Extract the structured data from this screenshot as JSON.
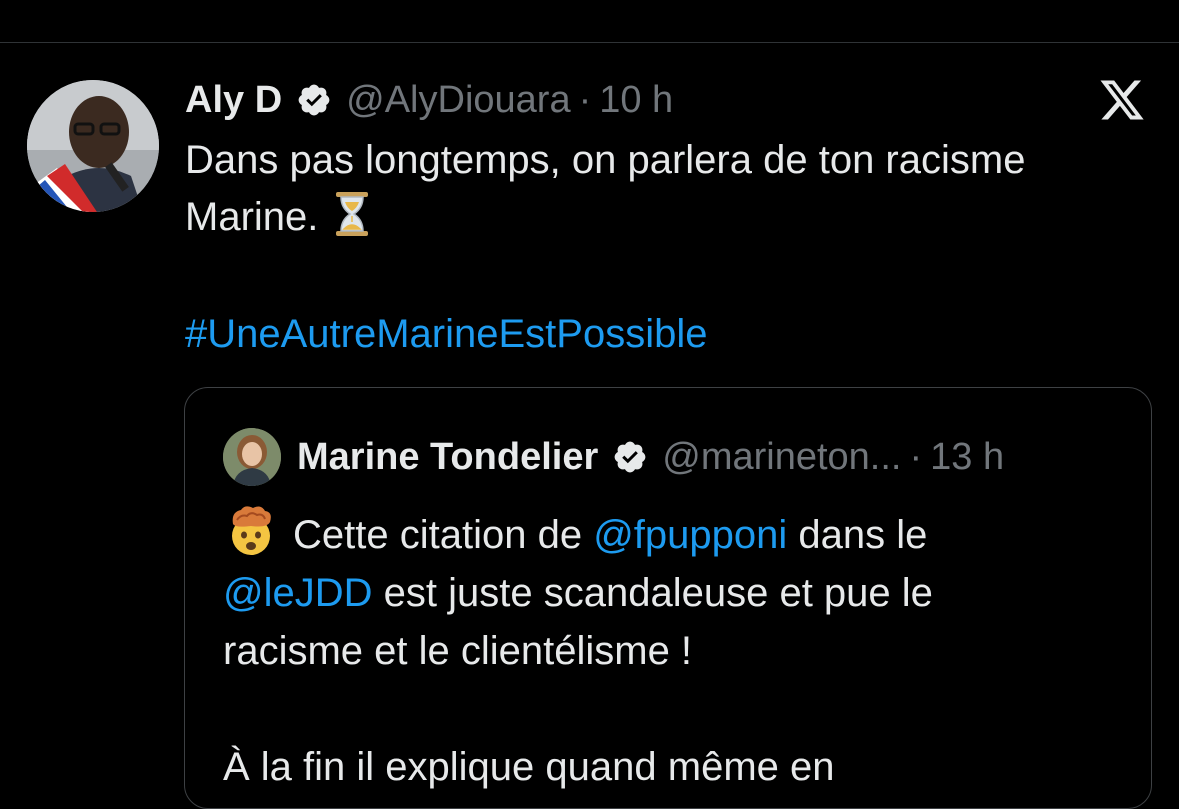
{
  "tweet": {
    "author_name": "Aly D",
    "author_handle": "@AlyDiouara",
    "separator": "·",
    "time": "10 h",
    "text_line1": "Dans pas longtemps, on parlera de ton racisme",
    "text_line2": "Marine.",
    "hashtag": "#UneAutreMarineEstPossible",
    "icons": [
      "verified-badge-icon",
      "x-logo-icon",
      "hourglass-emoji"
    ]
  },
  "quote": {
    "author_name": "Marine Tondelier",
    "author_handle": "@marineton...",
    "separator": "·",
    "time": "13 h",
    "line1_prefix": "Cette citation de",
    "line1_mention": "@fpupponi",
    "line1_suffix": "dans le",
    "line2_mention": "@leJDD",
    "line2_suffix": "est juste scandaleuse et pue le",
    "line3": "racisme et le clientélisme !",
    "line5": "À la fin il explique quand même en",
    "icons": [
      "exploding-head-emoji"
    ]
  },
  "colors": {
    "background": "#000000",
    "text": "#e7e9ea",
    "secondary": "#71767b",
    "link": "#1d9bf0",
    "border": "#3e4144"
  }
}
